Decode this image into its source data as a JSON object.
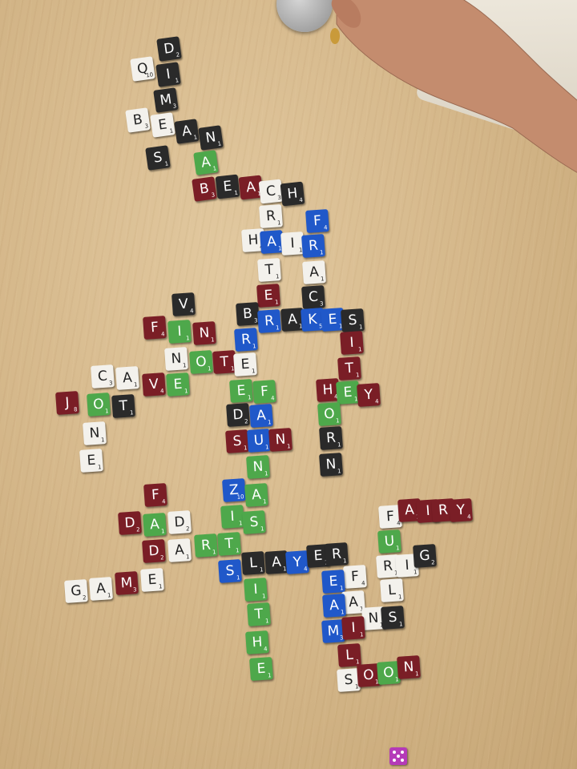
{
  "colors": {
    "white": "#f3f1ec",
    "black": "#2a2a2a",
    "green": "#4ea84b",
    "blue": "#2058c9",
    "red": "#7a1e26",
    "table": "#d6b98c"
  },
  "tiles": [
    {
      "id": "qi-q",
      "letter": "Q",
      "value": "10",
      "color": "white"
    },
    {
      "id": "dim-d",
      "letter": "D",
      "value": "2",
      "color": "black"
    },
    {
      "id": "dim-i",
      "letter": "I",
      "value": "1",
      "color": "black"
    },
    {
      "id": "dim-m",
      "letter": "M",
      "value": "3",
      "color": "black"
    },
    {
      "id": "bea-b",
      "letter": "B",
      "value": "3",
      "color": "white"
    },
    {
      "id": "bea-e",
      "letter": "E",
      "value": "1",
      "color": "white"
    },
    {
      "id": "bea-a",
      "letter": "A",
      "value": "1",
      "color": "black"
    },
    {
      "id": "bea-n",
      "letter": "N",
      "value": "1",
      "color": "black"
    },
    {
      "id": "s1",
      "letter": "S",
      "value": "1",
      "color": "black"
    },
    {
      "id": "a1",
      "letter": "A",
      "value": "1",
      "color": "green"
    },
    {
      "id": "beach-b",
      "letter": "B",
      "value": "3",
      "color": "red"
    },
    {
      "id": "beach-e",
      "letter": "E",
      "value": "1",
      "color": "black"
    },
    {
      "id": "beach-a",
      "letter": "A",
      "value": "1",
      "color": "red"
    },
    {
      "id": "beach-c",
      "letter": "C",
      "value": "3",
      "color": "white"
    },
    {
      "id": "beach-h",
      "letter": "H",
      "value": "4",
      "color": "black"
    },
    {
      "id": "r1",
      "letter": "R",
      "value": "1",
      "color": "white"
    },
    {
      "id": "f1",
      "letter": "F",
      "value": "4",
      "color": "blue"
    },
    {
      "id": "hair-h",
      "letter": "H",
      "value": "4",
      "color": "white"
    },
    {
      "id": "hair-a",
      "letter": "A",
      "value": "1",
      "color": "blue"
    },
    {
      "id": "hair-i",
      "letter": "I",
      "value": "1",
      "color": "white"
    },
    {
      "id": "hair-r",
      "letter": "R",
      "value": "1",
      "color": "blue"
    },
    {
      "id": "t1",
      "letter": "T",
      "value": "1",
      "color": "white"
    },
    {
      "id": "a2",
      "letter": "A",
      "value": "1",
      "color": "white"
    },
    {
      "id": "e1",
      "letter": "E",
      "value": "1",
      "color": "red"
    },
    {
      "id": "c1",
      "letter": "C",
      "value": "3",
      "color": "black"
    },
    {
      "id": "v1",
      "letter": "V",
      "value": "4",
      "color": "black"
    },
    {
      "id": "brakes-b",
      "letter": "B",
      "value": "3",
      "color": "black"
    },
    {
      "id": "brakes-r",
      "letter": "R",
      "value": "1",
      "color": "blue"
    },
    {
      "id": "brakes-a",
      "letter": "A",
      "value": "1",
      "color": "black"
    },
    {
      "id": "brakes-k",
      "letter": "K",
      "value": "5",
      "color": "blue"
    },
    {
      "id": "brakes-e",
      "letter": "E",
      "value": "1",
      "color": "blue"
    },
    {
      "id": "brakes-s",
      "letter": "S",
      "value": "1",
      "color": "black"
    },
    {
      "id": "fin-f",
      "letter": "F",
      "value": "4",
      "color": "red"
    },
    {
      "id": "fin-i",
      "letter": "I",
      "value": "1",
      "color": "green"
    },
    {
      "id": "fin-n",
      "letter": "N",
      "value": "1",
      "color": "red"
    },
    {
      "id": "r2",
      "letter": "R",
      "value": "1",
      "color": "blue"
    },
    {
      "id": "i1",
      "letter": "I",
      "value": "1",
      "color": "red"
    },
    {
      "id": "note-n",
      "letter": "N",
      "value": "1",
      "color": "white"
    },
    {
      "id": "note-o",
      "letter": "O",
      "value": "1",
      "color": "green"
    },
    {
      "id": "note-t",
      "letter": "T",
      "value": "1",
      "color": "red"
    },
    {
      "id": "note-e",
      "letter": "E",
      "value": "1",
      "color": "white"
    },
    {
      "id": "t2",
      "letter": "T",
      "value": "1",
      "color": "red"
    },
    {
      "id": "cave-c",
      "letter": "C",
      "value": "3",
      "color": "white"
    },
    {
      "id": "cave-a",
      "letter": "A",
      "value": "1",
      "color": "white"
    },
    {
      "id": "cave-v",
      "letter": "V",
      "value": "4",
      "color": "red"
    },
    {
      "id": "cave-e",
      "letter": "E",
      "value": "1",
      "color": "green"
    },
    {
      "id": "hey-h",
      "letter": "H",
      "value": "4",
      "color": "red"
    },
    {
      "id": "hey-e",
      "letter": "E",
      "value": "1",
      "color": "green"
    },
    {
      "id": "hey-y",
      "letter": "Y",
      "value": "4",
      "color": "red"
    },
    {
      "id": "j1",
      "letter": "J",
      "value": "8",
      "color": "red"
    },
    {
      "id": "o1",
      "letter": "O",
      "value": "1",
      "color": "green"
    },
    {
      "id": "t3",
      "letter": "T",
      "value": "1",
      "color": "black"
    },
    {
      "id": "e2",
      "letter": "E",
      "value": "1",
      "color": "green"
    },
    {
      "id": "f2",
      "letter": "F",
      "value": "4",
      "color": "green"
    },
    {
      "id": "o2",
      "letter": "O",
      "value": "1",
      "color": "green"
    },
    {
      "id": "n1",
      "letter": "N",
      "value": "1",
      "color": "white"
    },
    {
      "id": "d1",
      "letter": "D",
      "value": "2",
      "color": "black"
    },
    {
      "id": "a3",
      "letter": "A",
      "value": "1",
      "color": "blue"
    },
    {
      "id": "r3",
      "letter": "R",
      "value": "1",
      "color": "black"
    },
    {
      "id": "e3",
      "letter": "E",
      "value": "1",
      "color": "white"
    },
    {
      "id": "sun-s",
      "letter": "S",
      "value": "1",
      "color": "red"
    },
    {
      "id": "sun-u",
      "letter": "U",
      "value": "1",
      "color": "blue"
    },
    {
      "id": "sun-n",
      "letter": "N",
      "value": "1",
      "color": "red"
    },
    {
      "id": "n2",
      "letter": "N",
      "value": "1",
      "color": "black"
    },
    {
      "id": "n3",
      "letter": "N",
      "value": "1",
      "color": "green"
    },
    {
      "id": "z1",
      "letter": "Z",
      "value": "10",
      "color": "blue"
    },
    {
      "id": "a4",
      "letter": "A",
      "value": "1",
      "color": "green"
    },
    {
      "id": "i2",
      "letter": "I",
      "value": "1",
      "color": "green"
    },
    {
      "id": "s2",
      "letter": "S",
      "value": "1",
      "color": "green"
    },
    {
      "id": "f3",
      "letter": "F",
      "value": "4",
      "color": "red"
    },
    {
      "id": "dad-d1",
      "letter": "D",
      "value": "2",
      "color": "red"
    },
    {
      "id": "dad-a",
      "letter": "A",
      "value": "1",
      "color": "green"
    },
    {
      "id": "dad-d2",
      "letter": "D",
      "value": "2",
      "color": "white"
    },
    {
      "id": "d2",
      "letter": "D",
      "value": "2",
      "color": "red"
    },
    {
      "id": "a5",
      "letter": "A",
      "value": "1",
      "color": "white"
    },
    {
      "id": "game-g",
      "letter": "G",
      "value": "2",
      "color": "white"
    },
    {
      "id": "game-a",
      "letter": "A",
      "value": "1",
      "color": "white"
    },
    {
      "id": "game-m",
      "letter": "M",
      "value": "3",
      "color": "red"
    },
    {
      "id": "game-e",
      "letter": "E",
      "value": "1",
      "color": "white"
    },
    {
      "id": "rt-r",
      "letter": "R",
      "value": "1",
      "color": "green"
    },
    {
      "id": "rt-t",
      "letter": "T",
      "value": "1",
      "color": "green"
    },
    {
      "id": "fairy-f",
      "letter": "F",
      "value": "4",
      "color": "white"
    },
    {
      "id": "fairy-a",
      "letter": "A",
      "value": "1",
      "color": "red"
    },
    {
      "id": "fairy-i",
      "letter": "I",
      "value": "1",
      "color": "red"
    },
    {
      "id": "fairy-r",
      "letter": "R",
      "value": "1",
      "color": "red"
    },
    {
      "id": "fairy-y",
      "letter": "Y",
      "value": "4",
      "color": "red"
    },
    {
      "id": "u1",
      "letter": "U",
      "value": "1",
      "color": "green"
    },
    {
      "id": "rig-r",
      "letter": "R",
      "value": "1",
      "color": "white"
    },
    {
      "id": "rig-i",
      "letter": "I",
      "value": "1",
      "color": "white"
    },
    {
      "id": "rig-g",
      "letter": "G",
      "value": "2",
      "color": "black"
    },
    {
      "id": "slayer-s",
      "letter": "S",
      "value": "1",
      "color": "blue"
    },
    {
      "id": "slayer-l",
      "letter": "L",
      "value": "1",
      "color": "black"
    },
    {
      "id": "slayer-a",
      "letter": "A",
      "value": "1",
      "color": "black"
    },
    {
      "id": "slayer-y",
      "letter": "Y",
      "value": "4",
      "color": "blue"
    },
    {
      "id": "slayer-e",
      "letter": "E",
      "value": "1",
      "color": "black"
    },
    {
      "id": "slayer-r",
      "letter": "R",
      "value": "1",
      "color": "black"
    },
    {
      "id": "l1",
      "letter": "L",
      "value": "1",
      "color": "white"
    },
    {
      "id": "f4",
      "letter": "F",
      "value": "4",
      "color": "white"
    },
    {
      "id": "i3",
      "letter": "I",
      "value": "1",
      "color": "green"
    },
    {
      "id": "e4",
      "letter": "E",
      "value": "1",
      "color": "blue"
    },
    {
      "id": "a6",
      "letter": "A",
      "value": "1",
      "color": "white"
    },
    {
      "id": "t4",
      "letter": "T",
      "value": "1",
      "color": "green"
    },
    {
      "id": "a7",
      "letter": "A",
      "value": "1",
      "color": "blue"
    },
    {
      "id": "n4",
      "letter": "N",
      "value": "1",
      "color": "white"
    },
    {
      "id": "s3",
      "letter": "S",
      "value": "1",
      "color": "black"
    },
    {
      "id": "h1",
      "letter": "H",
      "value": "4",
      "color": "green"
    },
    {
      "id": "m1",
      "letter": "M",
      "value": "3",
      "color": "blue"
    },
    {
      "id": "i4",
      "letter": "I",
      "value": "1",
      "color": "red"
    },
    {
      "id": "e5",
      "letter": "E",
      "value": "1",
      "color": "green"
    },
    {
      "id": "l2",
      "letter": "L",
      "value": "1",
      "color": "red"
    },
    {
      "id": "soon-s",
      "letter": "S",
      "value": "1",
      "color": "white"
    },
    {
      "id": "soon-o1",
      "letter": "O",
      "value": "1",
      "color": "red"
    },
    {
      "id": "soon-o2",
      "letter": "O",
      "value": "1",
      "color": "green"
    },
    {
      "id": "soon-n",
      "letter": "N",
      "value": "1",
      "color": "red"
    }
  ]
}
